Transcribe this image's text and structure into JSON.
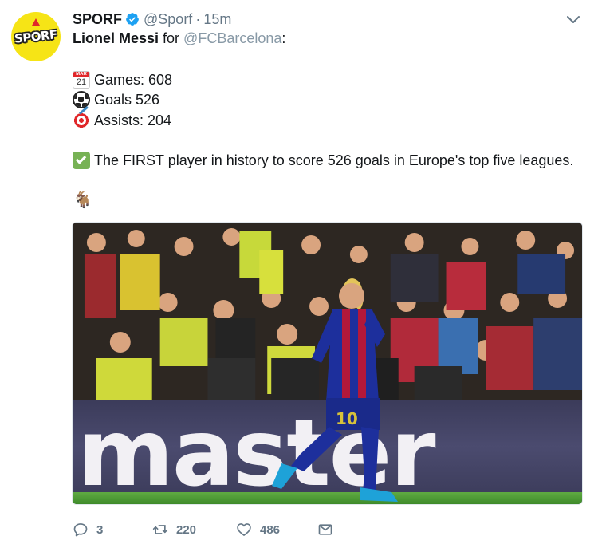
{
  "tweet": {
    "avatar_text": "SPORF",
    "display_name": "SPORF",
    "handle": "@Sporf",
    "separator": "·",
    "time": "15m",
    "line1": {
      "bold_text": "Lionel Messi",
      "connector": "for",
      "mention": "@FCBarcelona",
      "colon": ":"
    },
    "stats": {
      "calendar_month": "MAR",
      "calendar_day": "21",
      "games": "Games: 608",
      "goals": "Goals 526",
      "assists": "Assists: 204"
    },
    "first": "The FIRST player in history to score 526 goals in Europe's top five leagues.",
    "goat_emoji": "🐐",
    "media": {
      "board_text": "master",
      "jersey_number": "10"
    },
    "actions": {
      "reply_count": "3",
      "retweet_count": "220",
      "like_count": "486"
    }
  },
  "colors": {
    "verified": "#1da1f2",
    "mention": "#8899a6",
    "secondary": "#657786",
    "avatar_bg": "#f6e416",
    "check_bg": "#77b255"
  },
  "icons": {
    "verified": "verified-badge-icon",
    "caret": "chevron-down-icon",
    "calendar": "calendar-icon",
    "ball": "soccer-ball-icon",
    "target": "dart-target-icon",
    "check": "check-mark-icon",
    "goat": "goat-icon",
    "reply": "reply-icon",
    "retweet": "retweet-icon",
    "like": "heart-icon",
    "dm": "envelope-icon"
  }
}
